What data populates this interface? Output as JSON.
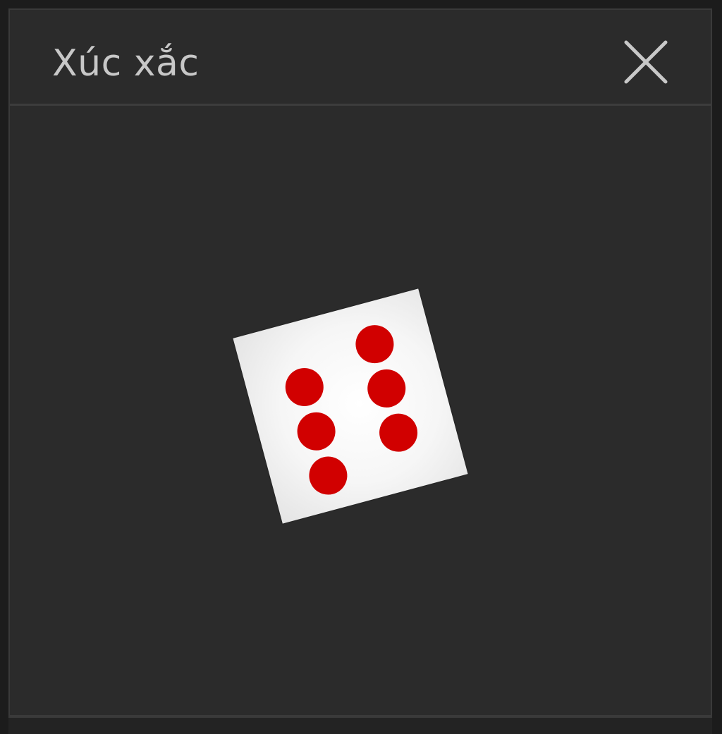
{
  "window": {
    "title": "Xúc xắc",
    "close_icon": "close-icon"
  },
  "dice": {
    "face_value": 6,
    "face_color": "#ffffff",
    "pip_color": "#d10000"
  },
  "colors": {
    "window_bg": "#2b2b2b",
    "title_text": "#c8c8c8",
    "page_bg": "#1c1c1c"
  }
}
